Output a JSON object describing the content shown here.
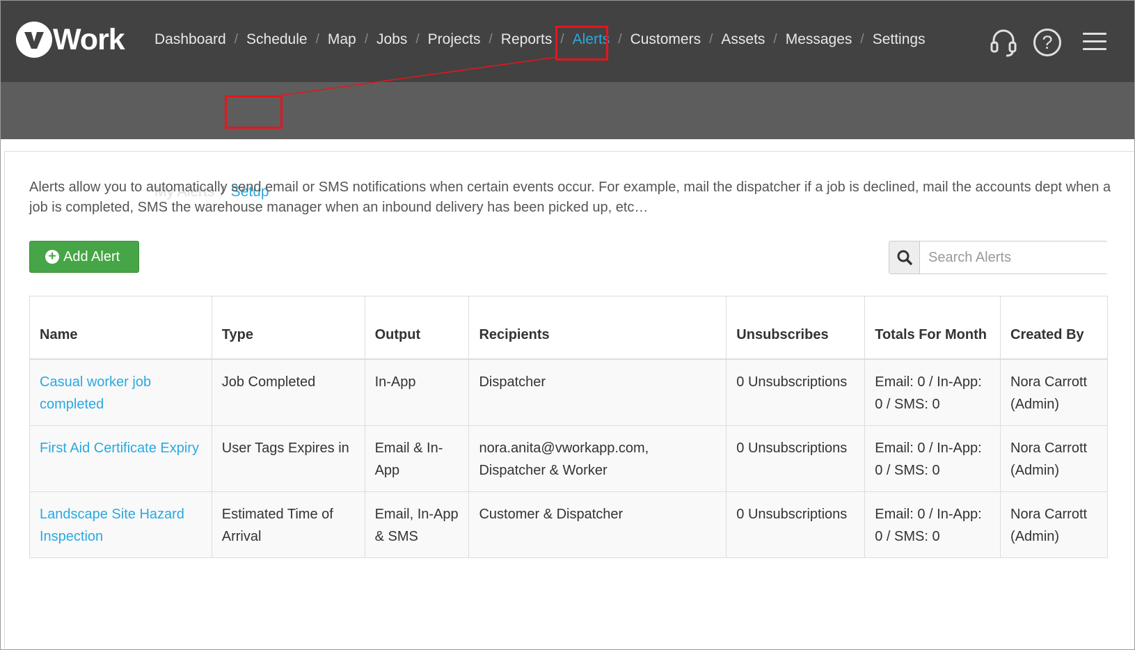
{
  "brand": {
    "name": "Work"
  },
  "colors": {
    "topbar": "#424242",
    "subbar": "#5d5d5d",
    "accent": "#29a9e1",
    "button_green": "#46a546",
    "highlight": "#e8141d"
  },
  "main_nav": [
    "Dashboard",
    "Schedule",
    "Map",
    "Jobs",
    "Projects",
    "Reports",
    "Alerts",
    "Customers",
    "Assets",
    "Messages",
    "Settings"
  ],
  "main_nav_active": "Alerts",
  "header_icons": [
    "headset-icon",
    "help-icon",
    "hamburger-menu-icon"
  ],
  "help_glyph": "?",
  "sub_nav": {
    "items": [
      "My Alerts",
      "Setup"
    ],
    "active": "Setup",
    "separator": "/"
  },
  "intro_text": "Alerts allow you to automatically send email or SMS notifications when certain events occur. For example, mail the dispatcher if a job is declined, mail the accounts dept when a job is completed, SMS the warehouse manager when an inbound delivery has been picked up, etc…",
  "add_button": {
    "label": "Add Alert",
    "icon": "plus-circle-icon"
  },
  "search": {
    "placeholder": "Search Alerts",
    "value": ""
  },
  "table": {
    "headers": [
      "Name",
      "Type",
      "Output",
      "Recipients",
      "Unsubscribes",
      "Totals For Month",
      "Created By"
    ],
    "rows": [
      [
        "Casual worker job completed",
        "Job Completed",
        "In-App",
        "Dispatcher",
        "0 Unsubscriptions",
        "Email: 0 / In-App: 0 / SMS: 0",
        "Nora Carrott (Admin)"
      ],
      [
        "First Aid Certificate Expiry",
        "User Tags Expires in",
        "Email & In-App",
        "nora.anita@vworkapp.com, Dispatcher & Worker",
        "0 Unsubscriptions",
        "Email: 0 / In-App: 0 / SMS: 0",
        "Nora Carrott (Admin)"
      ],
      [
        "Landscape Site Hazard Inspection",
        "Estimated Time of Arrival",
        "Email, In-App & SMS",
        "Customer & Dispatcher",
        "0 Unsubscriptions",
        "Email: 0 / In-App: 0 / SMS: 0",
        "Nora Carrott (Admin)"
      ]
    ]
  }
}
